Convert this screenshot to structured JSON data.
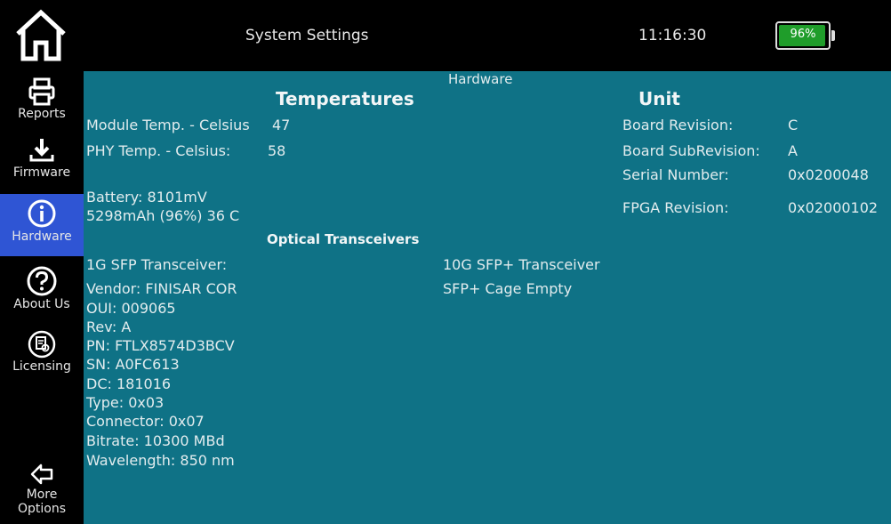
{
  "header": {
    "title": "System Settings",
    "time": "11:16:30",
    "battery_percent": "96%",
    "battery_level": 0.96,
    "battery_color": "#1f9d2a"
  },
  "sidebar": {
    "active_color": "#2f55d4",
    "items": [
      {
        "label": "Reports",
        "icon": "printer-icon"
      },
      {
        "label": "Firmware",
        "icon": "download-icon"
      },
      {
        "label": "Hardware",
        "icon": "info-icon"
      },
      {
        "label": "About Us",
        "icon": "help-icon"
      },
      {
        "label": "Licensing",
        "icon": "license-icon"
      },
      {
        "label_line1": "More",
        "label_line2": "Options",
        "icon": "back-arrow-icon"
      }
    ]
  },
  "main": {
    "background": "#0f7286",
    "section_title": "Hardware",
    "temperatures": {
      "heading": "Temperatures",
      "module_label": "Module Temp. - Celsius",
      "module_value": "47",
      "phy_label": "PHY Temp. - Celsius:",
      "phy_value": "58"
    },
    "battery": {
      "line1": "Battery: 8101mV",
      "line2": "5298mAh (96%) 36 C"
    },
    "unit": {
      "heading": "Unit",
      "rows": [
        {
          "label": "Board Revision:",
          "value": "C"
        },
        {
          "label": "Board SubRevision:",
          "value": "A"
        },
        {
          "label": "Serial Number:",
          "value": "0x0200048"
        },
        {
          "label": "FPGA Revision:",
          "value": "0x02000102"
        }
      ]
    },
    "optical": {
      "heading": "Optical Transceivers",
      "sfp1g": {
        "title": "1G SFP Transceiver:",
        "lines": [
          "Vendor: FINISAR COR",
          "OUI: 009065",
          "Rev: A",
          "PN: FTLX8574D3BCV",
          "SN: A0FC613",
          "DC: 181016",
          "Type: 0x03",
          "Connector: 0x07",
          "Bitrate: 10300 MBd",
          "Wavelength: 850 nm"
        ]
      },
      "sfp10g": {
        "title": "10G SFP+ Transceiver",
        "status": "SFP+ Cage Empty"
      }
    }
  }
}
